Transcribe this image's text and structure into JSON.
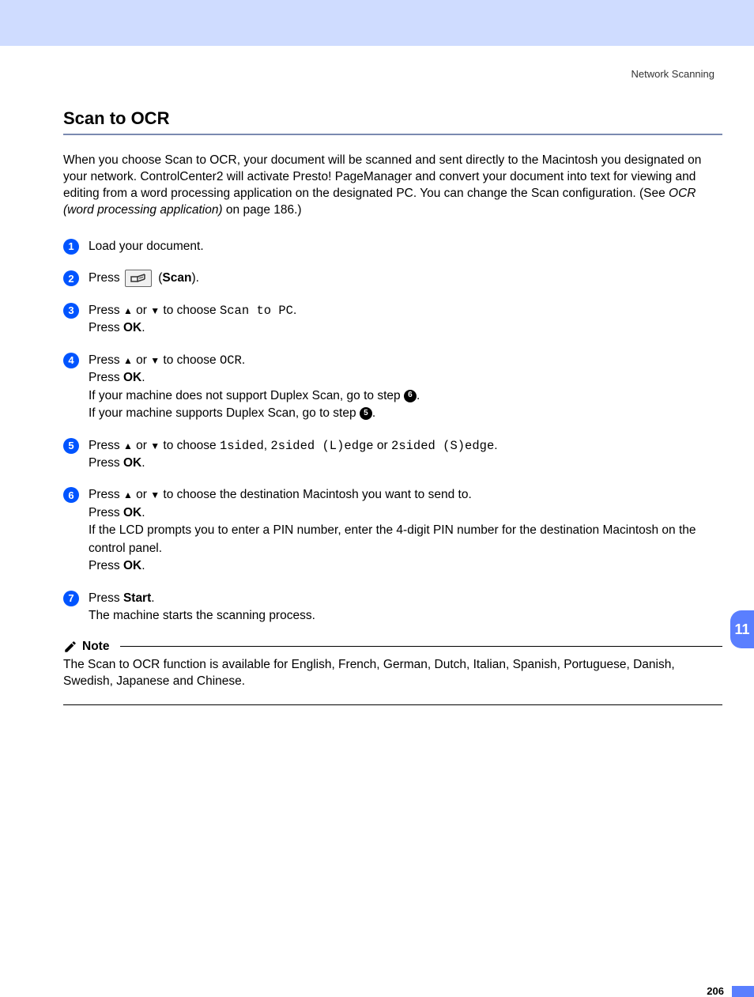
{
  "header": {
    "section": "Network Scanning"
  },
  "title": "Scan to OCR",
  "intro": {
    "part1": "When you choose Scan to OCR, your document will be scanned and sent directly to the Macintosh you designated on your network. ControlCenter2 will activate Presto! PageManager and convert your document into text for viewing and editing from a word processing application on the designated PC. You can change the Scan configuration. (See ",
    "part2_italic": "OCR (word processing application)",
    "part3": " on page 186.)"
  },
  "glyphs": {
    "up": "▲",
    "down": "▼"
  },
  "steps": [
    {
      "num": "1",
      "lines": [
        {
          "segments": [
            {
              "t": "Load your document."
            }
          ]
        }
      ]
    },
    {
      "num": "2",
      "lines": [
        {
          "segments": [
            {
              "t": "Press "
            },
            {
              "icon": "scan"
            },
            {
              "t": " ("
            },
            {
              "t": "Scan",
              "bold": true
            },
            {
              "t": ")."
            }
          ]
        }
      ]
    },
    {
      "num": "3",
      "lines": [
        {
          "segments": [
            {
              "t": "Press "
            },
            {
              "arrow": "up"
            },
            {
              "t": " or "
            },
            {
              "arrow": "down"
            },
            {
              "t": " to choose "
            },
            {
              "t": "Scan to PC",
              "mono": true
            },
            {
              "t": "."
            }
          ]
        },
        {
          "segments": [
            {
              "t": "Press "
            },
            {
              "t": "OK",
              "bold": true
            },
            {
              "t": "."
            }
          ]
        }
      ]
    },
    {
      "num": "4",
      "lines": [
        {
          "segments": [
            {
              "t": "Press "
            },
            {
              "arrow": "up"
            },
            {
              "t": " or "
            },
            {
              "arrow": "down"
            },
            {
              "t": " to choose "
            },
            {
              "t": "OCR",
              "mono": true
            },
            {
              "t": "."
            }
          ]
        },
        {
          "segments": [
            {
              "t": "Press "
            },
            {
              "t": "OK",
              "bold": true
            },
            {
              "t": "."
            }
          ]
        },
        {
          "segments": [
            {
              "t": "If your machine does not support Duplex Scan, go to step "
            },
            {
              "circ": "6"
            },
            {
              "t": "."
            }
          ]
        },
        {
          "segments": [
            {
              "t": "If your machine supports Duplex Scan, go to step "
            },
            {
              "circ": "5"
            },
            {
              "t": "."
            }
          ]
        }
      ]
    },
    {
      "num": "5",
      "lines": [
        {
          "segments": [
            {
              "t": "Press "
            },
            {
              "arrow": "up"
            },
            {
              "t": " or "
            },
            {
              "arrow": "down"
            },
            {
              "t": " to choose "
            },
            {
              "t": "1sided",
              "mono": true
            },
            {
              "t": ", "
            },
            {
              "t": "2sided (L)edge",
              "mono": true
            },
            {
              "t": " or "
            },
            {
              "t": "2sided (S)edge",
              "mono": true
            },
            {
              "t": "."
            }
          ]
        },
        {
          "segments": [
            {
              "t": "Press "
            },
            {
              "t": "OK",
              "bold": true
            },
            {
              "t": "."
            }
          ]
        }
      ]
    },
    {
      "num": "6",
      "lines": [
        {
          "segments": [
            {
              "t": "Press "
            },
            {
              "arrow": "up"
            },
            {
              "t": " or "
            },
            {
              "arrow": "down"
            },
            {
              "t": " to choose the destination Macintosh you want to send to."
            }
          ]
        },
        {
          "segments": [
            {
              "t": "Press "
            },
            {
              "t": "OK",
              "bold": true
            },
            {
              "t": "."
            }
          ]
        },
        {
          "segments": [
            {
              "t": "If the LCD prompts you to enter a PIN number, enter the 4-digit PIN number for the destination Macintosh on the control panel."
            }
          ]
        },
        {
          "segments": [
            {
              "t": "Press "
            },
            {
              "t": "OK",
              "bold": true
            },
            {
              "t": "."
            }
          ]
        }
      ]
    },
    {
      "num": "7",
      "lines": [
        {
          "segments": [
            {
              "t": "Press "
            },
            {
              "t": "Start",
              "bold": true
            },
            {
              "t": "."
            }
          ]
        },
        {
          "segments": [
            {
              "t": "The machine starts the scanning process."
            }
          ]
        }
      ]
    }
  ],
  "note": {
    "label": "Note",
    "text": "The Scan to OCR function is available for English, French, German, Dutch, Italian, Spanish, Portuguese, Danish, Swedish, Japanese and Chinese."
  },
  "side_tab": "11",
  "page_number": "206"
}
